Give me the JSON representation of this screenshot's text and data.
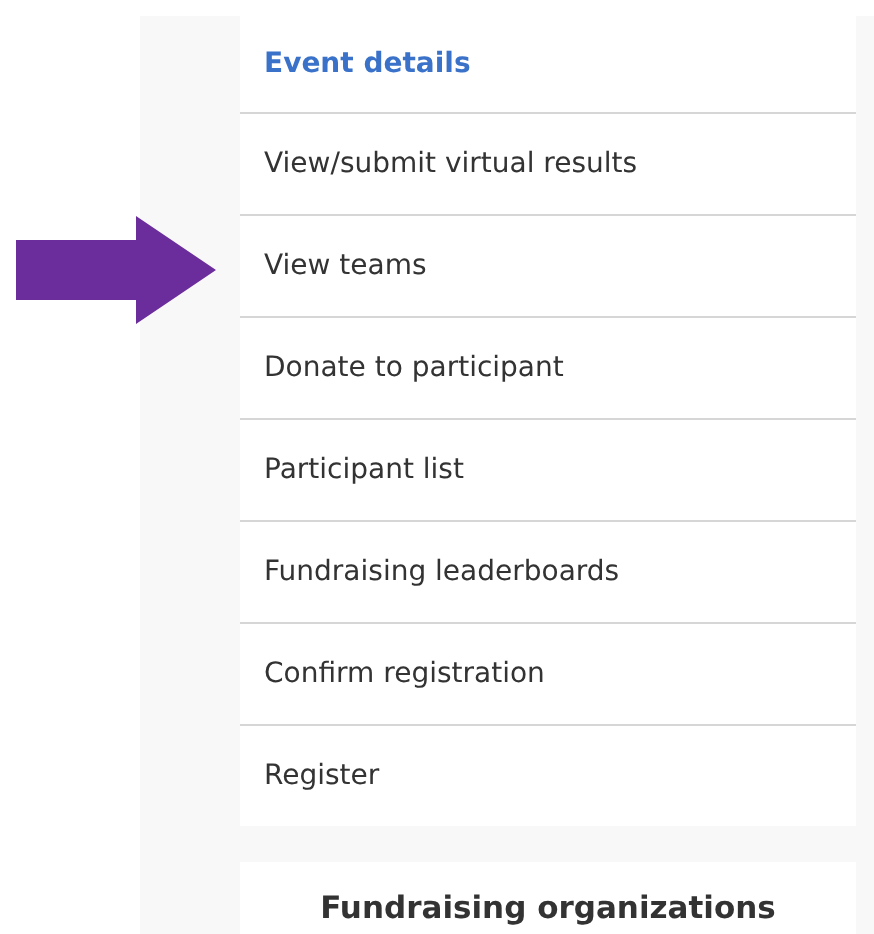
{
  "menu": {
    "items": [
      {
        "label": "Event details",
        "selected": true,
        "pointed_at": false
      },
      {
        "label": "View/submit virtual results",
        "selected": false,
        "pointed_at": false
      },
      {
        "label": "View teams",
        "selected": false,
        "pointed_at": true
      },
      {
        "label": "Donate to participant",
        "selected": false,
        "pointed_at": false
      },
      {
        "label": "Participant list",
        "selected": false,
        "pointed_at": false
      },
      {
        "label": "Fundraising leaderboards",
        "selected": false,
        "pointed_at": false
      },
      {
        "label": "Confirm registration",
        "selected": false,
        "pointed_at": false
      },
      {
        "label": "Register",
        "selected": false,
        "pointed_at": false
      }
    ]
  },
  "section": {
    "title": "Fundraising organizations"
  }
}
